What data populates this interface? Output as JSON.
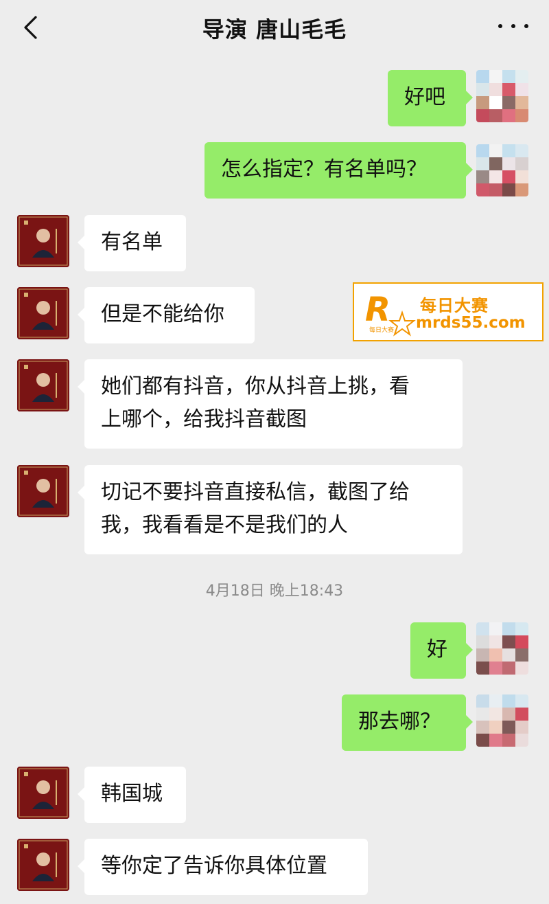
{
  "header": {
    "title": "导演 唐山毛毛"
  },
  "messages": [
    {
      "side": "self",
      "text": "好吧"
    },
    {
      "side": "self",
      "text": "怎么指定？有名单吗？"
    },
    {
      "side": "other",
      "text": "有名单"
    },
    {
      "side": "other",
      "text": "但是不能给你"
    },
    {
      "side": "other",
      "text_lines": [
        "她们都有抖音，你从抖音上挑，看",
        "上哪个，给我抖音截图"
      ]
    },
    {
      "side": "other",
      "text_lines": [
        "切记不要抖音直接私信，截图了给",
        "我，我看看是不是我们的人"
      ]
    },
    {
      "side": "self",
      "text": "好"
    },
    {
      "side": "self",
      "text": "那去哪？"
    },
    {
      "side": "other",
      "text": "韩国城"
    },
    {
      "side": "other",
      "text": "等你定了告诉你具体位置"
    }
  ],
  "timestamp": "4月18日 晚上18:43",
  "watermark": {
    "logo_letter": "R",
    "logo_small_text": "每日大赛",
    "name": "每日大赛",
    "url": "mrds55.com"
  },
  "colors": {
    "background": "#ededed",
    "self_bubble": "#95ec69",
    "other_bubble": "#ffffff",
    "watermark": "#f29400"
  }
}
